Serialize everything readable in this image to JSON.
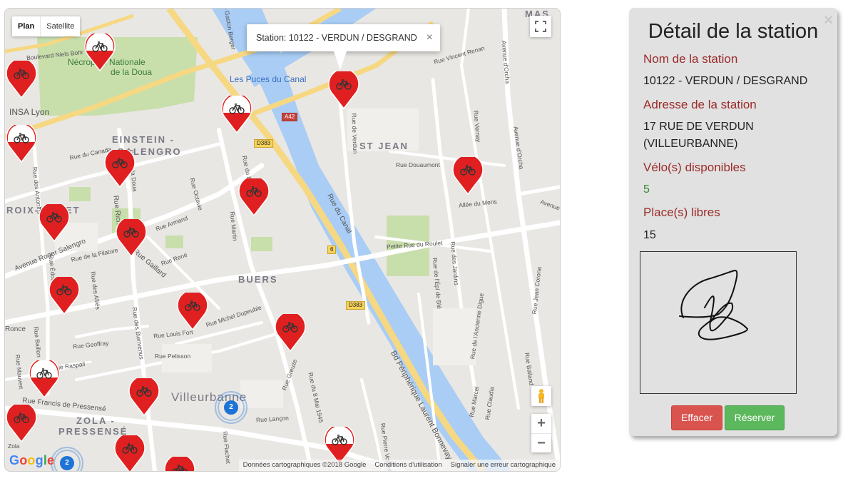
{
  "map": {
    "type_controls": [
      "Plan",
      "Satellite"
    ],
    "info_window": "Station: 10122 - VERDUN / DESGRAND",
    "info_close": "×",
    "zoom_in": "+",
    "zoom_out": "−",
    "attribution": [
      "Données cartographiques ©2018 Google",
      "Conditions d'utilisation",
      "Signaler une erreur cartographique"
    ],
    "areas": [
      "EINSTEIN -",
      "SALENGRO",
      "ST JEAN",
      "ROIX-LUIZET",
      "BUERS",
      "Villeurbanne",
      "ZOLA -",
      "PRESSENSÉ",
      "MAS"
    ],
    "pois": [
      "Nécropole Nationale",
      "de la Doua",
      "Les Puces du Canal",
      "INSA Lyon"
    ],
    "streets": [
      "Boulevard Niels Bohr",
      "Rue du Canada",
      "Rue Octavie",
      "Rue du 8",
      "Rue de Verdun",
      "Rue Douaumont",
      "Allée du Mens",
      "Rue du Canal",
      "Petite Rue du Roulet",
      "Rue des Jardins",
      "Rue de l'Épi de Blé",
      "Rue de l'Ancienne Digue",
      "Avenue d'Orcha",
      "Avenue d'Orcha",
      "Rue Armand",
      "Rue de la Filature",
      "Rue René",
      "Rue Michel Dupeuble",
      "Rue Louis Fort",
      "Rue Pelisson",
      "Rue Geoffray",
      "Rue Raspail",
      "Rue Francis de Pressensé",
      "Rue Lançon",
      "Rue Greuze",
      "Rue du 8 Mai 1945",
      "Rue des Bienvenus",
      "Rue des Alliés",
      "Rue Marcel",
      "Rue Claudia",
      "Rue Jean Corona",
      "Rue Balland",
      "Rue Pierre Voyant",
      "Bd Périphérique Laurent Bonnevay",
      "Avenue Roger Salengro",
      "Rue Édouard",
      "Rue des Antonins",
      "Rue Baillon",
      "Rue Mauvert",
      "Rue Flachet",
      "Rue Richard",
      "Rue Vernay",
      "Rue Vincent Renan",
      "Avenue Gaston Berger",
      "Zola",
      "Avenue",
      "Ronce",
      "Rue Gaillard",
      "Rue de la Doua",
      "Rue Martin"
    ],
    "shields": [
      "A42",
      "D383",
      "D383",
      "6"
    ],
    "clusters": [
      "2",
      "2"
    ]
  },
  "panel": {
    "close": "×",
    "title": "Détail de la station",
    "name_label": "Nom de la station",
    "name_value": "10122 - VERDUN / DESGRAND",
    "address_label": "Adresse de la station",
    "address_value": "17 RUE DE VERDUN (VILLEURBANNE)",
    "bikes_label": "Vélo(s) disponibles",
    "bikes_value": "5",
    "places_label": "Place(s) libres",
    "places_value": "15",
    "clear_button": "Effacer",
    "reserve_button": "Réserver"
  },
  "colors": {
    "marker_red": "#e02020",
    "label_red": "#9b2a2a",
    "available_green": "#2d8a2d",
    "water": "#a9cdf5",
    "park": "#c8dfac",
    "highway": "#f7d882"
  },
  "icons": [
    "bicycle-icon",
    "fullscreen-icon",
    "pegman-icon",
    "close-icon"
  ]
}
